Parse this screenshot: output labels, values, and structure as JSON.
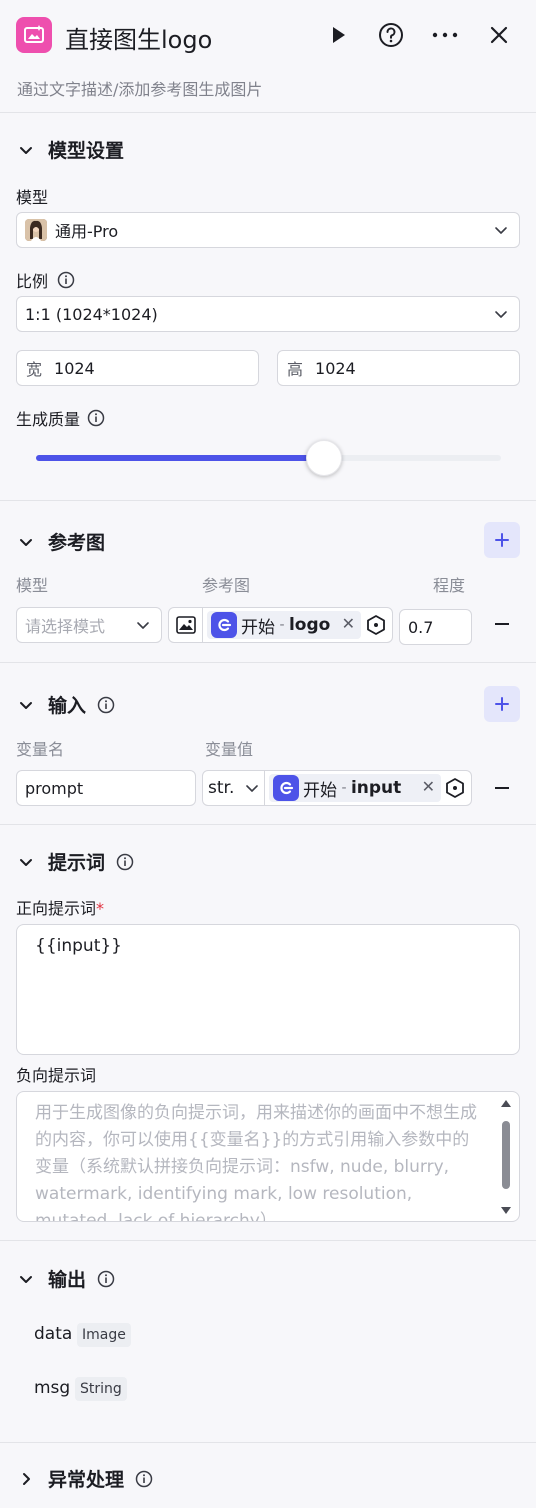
{
  "header": {
    "title": "直接图生logo",
    "subtitle": "通过文字描述/添加参考图生成图片"
  },
  "model_settings": {
    "section_title": "模型设置",
    "model_label": "模型",
    "model_value": "通用-Pro",
    "ratio_label": "比例",
    "ratio_value": "1:1 (1024*1024)",
    "width_prefix": "宽",
    "width_value": "1024",
    "height_prefix": "高",
    "height_value": "1024",
    "quality_label": "生成质量",
    "quality_level": 0.62
  },
  "reference": {
    "section_title": "参考图",
    "col_model": "模型",
    "col_image": "参考图",
    "col_degree": "程度",
    "model_placeholder": "请选择模式",
    "tag_source": "开始",
    "tag_sep": " - ",
    "tag_var": "logo",
    "degree_value": "0.7"
  },
  "input": {
    "section_title": "输入",
    "col_name": "变量名",
    "col_value": "变量值",
    "var_name": "prompt",
    "type_value": "str.",
    "tag_source": "开始",
    "tag_sep": " - ",
    "tag_var": "input"
  },
  "prompt": {
    "section_title": "提示词",
    "positive_label": "正向提示词",
    "required_mark": "*",
    "positive_value": "{{input}}",
    "negative_label": "负向提示词",
    "negative_placeholder": "用于生成图像的负向提示词，用来描述你的画面中不想生成的内容，你可以使用{{变量名}}的方式引用输入参数中的变量（系统默认拼接负向提示词：nsfw, nude, blurry, watermark, identifying mark, low resolution, mutated, lack of hierarchy）"
  },
  "output": {
    "section_title": "输出",
    "items": [
      {
        "name": "data",
        "type": "Image"
      },
      {
        "name": "msg",
        "type": "String"
      }
    ]
  },
  "exception": {
    "section_title": "异常处理"
  },
  "colors": {
    "accent": "#4d53e8",
    "icon_pink": "#ee4fae",
    "background": "#f7f7fa"
  },
  "icons": [
    "image-gen-icon",
    "play-icon",
    "help-icon",
    "more-icon",
    "close-icon",
    "chevron-down-icon",
    "chevron-right-icon",
    "info-icon",
    "plus-icon",
    "minus-icon",
    "image-icon",
    "hexagon-icon"
  ]
}
